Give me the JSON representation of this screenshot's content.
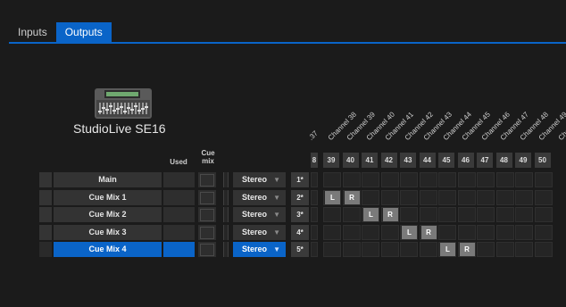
{
  "tabs": [
    {
      "label": "Inputs",
      "active": false
    },
    {
      "label": "Outputs",
      "active": true
    }
  ],
  "device": {
    "name": "StudioLive SE16",
    "image_icon": "mixer-console-icon"
  },
  "columns": {
    "used": "Used",
    "cue_mix": "Cue\nmix"
  },
  "channels": {
    "labels": [
      ".37",
      "Channel 38",
      "Channel 39",
      "Channel 40",
      "Channel 41",
      "Channel 42",
      "Channel 43",
      "Channel 44",
      "Channel 45",
      "Channel 46",
      "Channel 47",
      "Channel 48",
      "Channel 49",
      "Chan"
    ],
    "numbers": [
      "8",
      "39",
      "40",
      "41",
      "42",
      "43",
      "44",
      "45",
      "46",
      "47",
      "48",
      "49",
      "50"
    ]
  },
  "rows": [
    {
      "name": "Main",
      "mode": "Stereo",
      "num": "1*",
      "selected": false,
      "lr": []
    },
    {
      "name": "Cue Mix 1",
      "mode": "Stereo",
      "num": "2*",
      "selected": false,
      "lr": [
        {
          "col": 1,
          "text": "L"
        },
        {
          "col": 2,
          "text": "R"
        }
      ]
    },
    {
      "name": "Cue Mix 2",
      "mode": "Stereo",
      "num": "3*",
      "selected": false,
      "lr": [
        {
          "col": 3,
          "text": "L"
        },
        {
          "col": 4,
          "text": "R"
        }
      ]
    },
    {
      "name": "Cue Mix 3",
      "mode": "Stereo",
      "num": "4*",
      "selected": false,
      "lr": [
        {
          "col": 5,
          "text": "L"
        },
        {
          "col": 6,
          "text": "R"
        }
      ]
    },
    {
      "name": "Cue Mix 4",
      "mode": "Stereo",
      "num": "5*",
      "selected": true,
      "lr": [
        {
          "col": 7,
          "text": "L"
        },
        {
          "col": 8,
          "text": "R"
        }
      ]
    }
  ],
  "colors": {
    "accent": "#0a64c8",
    "background": "#1b1b1b"
  }
}
